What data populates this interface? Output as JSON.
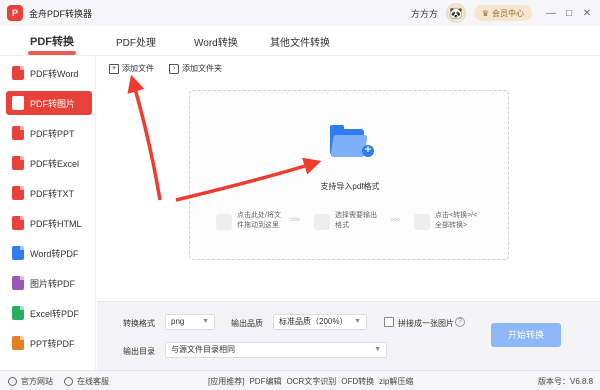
{
  "titlebar": {
    "logo": "P",
    "title": "金舟PDF转换器",
    "username": "方方方",
    "avatar_icon": "🐼",
    "vip": "会员中心",
    "min": "—",
    "max": "□",
    "close": "✕"
  },
  "topnav": {
    "tabs": [
      "PDF转换",
      "PDF处理",
      "Word转换",
      "其他文件转换"
    ]
  },
  "sidebar": {
    "items": [
      {
        "label": "PDF转Word",
        "color": "#e8413a"
      },
      {
        "label": "PDF转图片",
        "color": "#ffffff"
      },
      {
        "label": "PDF转PPT",
        "color": "#e8413a"
      },
      {
        "label": "PDF转Excel",
        "color": "#e8413a"
      },
      {
        "label": "PDF转TXT",
        "color": "#e8413a"
      },
      {
        "label": "PDF转HTML",
        "color": "#e8413a"
      },
      {
        "label": "Word转PDF",
        "color": "#2f7cf3"
      },
      {
        "label": "图片转PDF",
        "color": "#9b59b6"
      },
      {
        "label": "Excel转PDF",
        "color": "#27ae60"
      },
      {
        "label": "PPT转PDF",
        "color": "#e67e22"
      }
    ]
  },
  "toolbar": {
    "add_file": "添加文件",
    "add_folder": "添加文件夹"
  },
  "dropzone": {
    "label": "支持导入pdf格式",
    "steps": [
      "点击此处/将文件拖动到这里",
      "选择需要输出格式",
      "点击<转换>/<全部转换>"
    ],
    "arrow": ">>>"
  },
  "settings": {
    "format_label": "转换格式",
    "format_value": "png",
    "quality_label": "输出品质",
    "quality_value": "标准品质（200%）",
    "merge_label": "拼接成一张图片",
    "help": "?",
    "output_label": "输出目录",
    "output_value": "与源文件目录相同",
    "start_button": "开始转换"
  },
  "statusbar": {
    "website": "官方网站",
    "service": "在线客服",
    "links": [
      "[应用推荐]",
      "PDF编辑",
      "OCR文字识别",
      "OFD转换",
      "zip解压缩"
    ],
    "version": "版本号：V6.8.8"
  },
  "colors": {
    "brand": "#e8413a",
    "accent": "#2f7cf3",
    "annotation": "#f23b2f"
  }
}
